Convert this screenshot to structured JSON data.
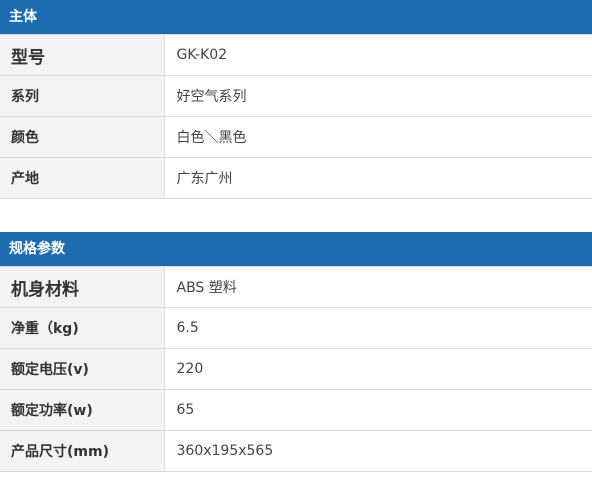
{
  "main_section": {
    "title": "主体",
    "rows": [
      {
        "key": "型号",
        "value": "GK-K02"
      },
      {
        "key": "系列",
        "value": "好空气系列"
      },
      {
        "key": "颜色",
        "value": "白色＼黑色"
      },
      {
        "key": "产地",
        "value": "广东广州"
      }
    ]
  },
  "spec_section": {
    "title": "规格参数",
    "rows": [
      {
        "key": "机身材料",
        "value": "ABS 塑料"
      },
      {
        "key": "净重（kg)",
        "value": "6.5"
      },
      {
        "key": "额定电压(v)",
        "value": "220"
      },
      {
        "key": "额定功率(w)",
        "value": "65"
      },
      {
        "key": "产品尺寸(mm)",
        "value": "360x195x565"
      }
    ]
  },
  "colors": {
    "header_bg": "#1e6cb0",
    "key_bg": "#f3f3f3",
    "border": "#dcdcdc"
  }
}
